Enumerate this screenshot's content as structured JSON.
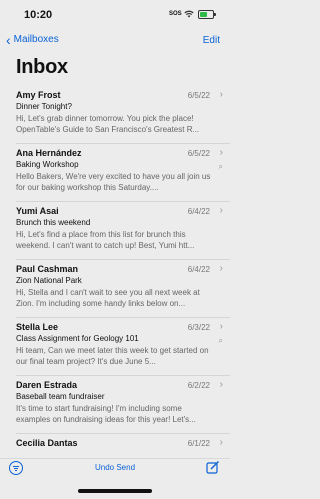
{
  "status": {
    "time": "10:20",
    "sos": "SOS"
  },
  "nav": {
    "back_label": "Mailboxes",
    "edit_label": "Edit"
  },
  "title": "Inbox",
  "emails": [
    {
      "sender": "Amy Frost",
      "date": "6/5/22",
      "subject": "Dinner Tonight?",
      "preview": "Hi, Let's grab dinner tomorrow. You pick the place! OpenTable's Guide to San Francisco's Greatest R...",
      "attachment": false
    },
    {
      "sender": "Ana Hernández",
      "date": "6/5/22",
      "subject": "Baking Workshop",
      "preview": "Hello Bakers, We're very excited to have you all join us for our baking workshop this Saturday....",
      "attachment": true
    },
    {
      "sender": "Yumi Asai",
      "date": "6/4/22",
      "subject": "Brunch this weekend",
      "preview": "Hi, Let's find a place from this list for brunch this weekend. I can't want to catch up! Best, Yumi htt...",
      "attachment": false
    },
    {
      "sender": "Paul Cashman",
      "date": "6/4/22",
      "subject": "Zion National Park",
      "preview": "Hi, Stella and I can't wait to see you all next week at Zion. I'm including some handy links below on...",
      "attachment": false
    },
    {
      "sender": "Stella Lee",
      "date": "6/3/22",
      "subject": "Class Assignment for Geology 101",
      "preview": "Hi team, Can we meet later this week to get started on our final team project? It's due June 5...",
      "attachment": true
    },
    {
      "sender": "Daren Estrada",
      "date": "6/2/22",
      "subject": "Baseball team fundraiser",
      "preview": "It's time to start fundraising! I'm including some examples on fundraising ideas for this year! Let's...",
      "attachment": false
    },
    {
      "sender": "Cecilia Dantas",
      "date": "6/1/22",
      "subject": "",
      "preview": "",
      "attachment": false
    }
  ],
  "toolbar": {
    "undo_label": "Undo Send"
  },
  "colors": {
    "accent": "#0a62d6",
    "background": "#ececec",
    "battery": "#2fbb4a"
  }
}
